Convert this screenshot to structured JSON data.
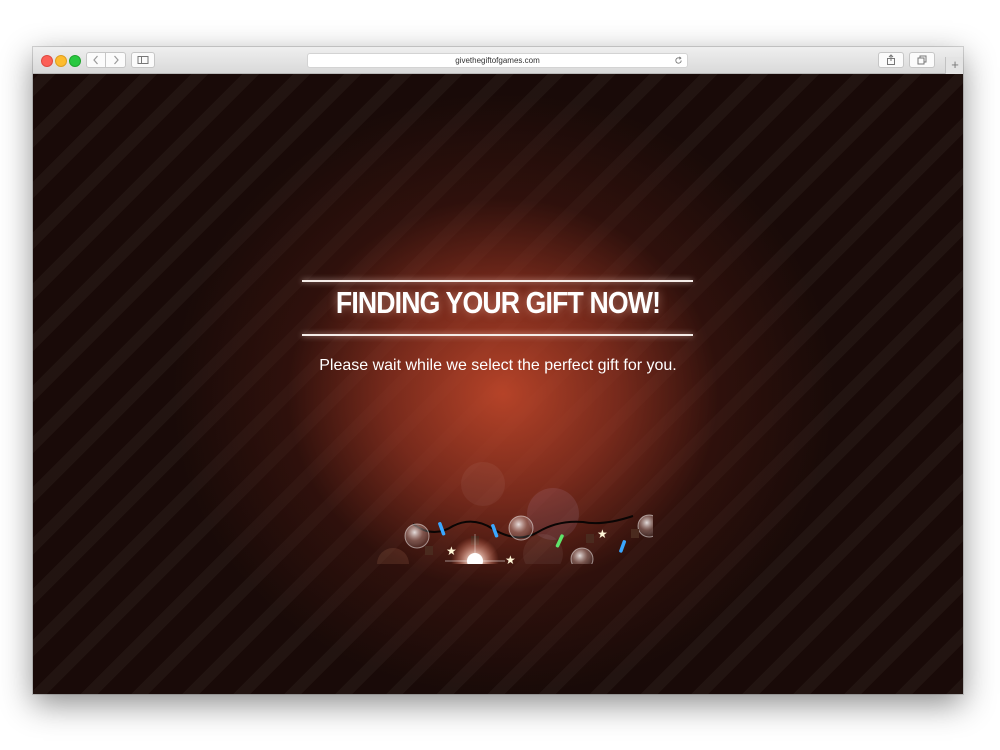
{
  "browser": {
    "url": "givethegiftofgames.com",
    "icons": {
      "back": "chevron-left-icon",
      "forward": "chevron-right-icon",
      "sidebar": "sidebar-icon",
      "reload": "reload-icon",
      "share": "share-icon",
      "tabs": "tabs-icon",
      "new_tab": "plus-icon"
    },
    "new_tab_label": "+"
  },
  "page": {
    "headline": "FINDING YOUR GIFT NOW!",
    "subtitle": "Please wait while we select the perfect gift for you.",
    "decoration": "christmas-lights-icon",
    "colors": {
      "background": "#1a0b08",
      "glow": "#be462a",
      "text": "#ffffff"
    }
  }
}
